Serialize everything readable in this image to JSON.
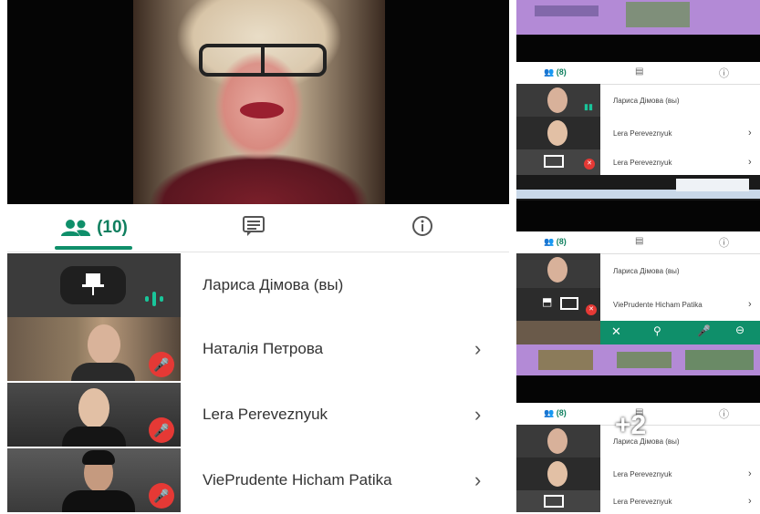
{
  "main": {
    "tabs": {
      "people_count": "(10)"
    },
    "participants": [
      {
        "name": "Лариса Дімова (вы)",
        "muted": false,
        "speaking": true
      },
      {
        "name": "Наталія Петрова",
        "muted": true
      },
      {
        "name": "Lera Pereveznyuk",
        "muted": true
      },
      {
        "name": "ViePrudente Hicham Patika",
        "muted": true
      }
    ]
  },
  "right": {
    "panel1": {
      "people_count": "(8)",
      "participants": [
        {
          "name": "Лариса Дімова (вы)"
        },
        {
          "name": "Lera Pereveznyuk"
        },
        {
          "name": "Lera Pereveznyuk"
        }
      ]
    },
    "panel2": {
      "people_count": "(8)",
      "participants": [
        {
          "name": "Лариса Дімова (вы)"
        },
        {
          "name": "ViePrudente Hicham Patika"
        }
      ]
    },
    "panel3": {
      "people_count": "(8)",
      "overlay": "+2",
      "participants": [
        {
          "name": "Лариса Дімова (вы)"
        },
        {
          "name": "Lera Pereveznyuk"
        },
        {
          "name": "Lera Pereveznyuk"
        }
      ]
    }
  },
  "colors": {
    "accent": "#0f8f6a",
    "mic_off": "#e53935",
    "banner": "#b38ad6"
  }
}
